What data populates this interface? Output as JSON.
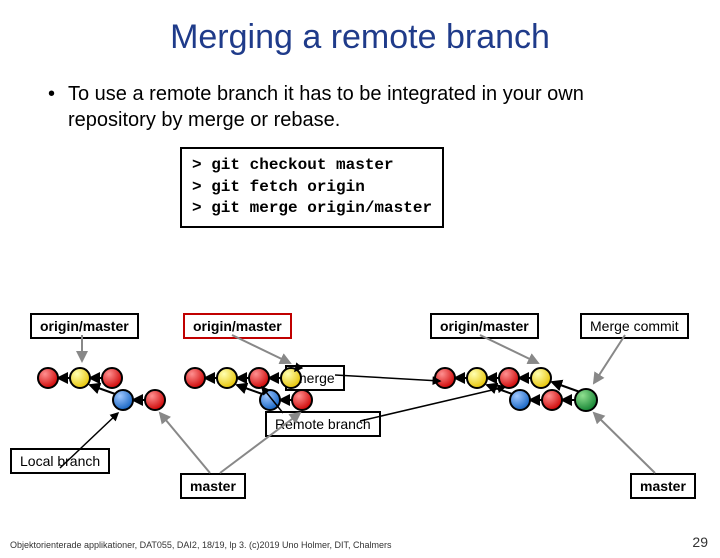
{
  "title": "Merging a remote branch",
  "bullet": "To use a remote branch it has to be integrated in your own repository by merge or rebase.",
  "code": "> git checkout master\n> git fetch origin\n> git merge origin/master",
  "labels": {
    "om1": "origin/master",
    "om2": "origin/master",
    "om3": "origin/master",
    "mergeCommit": "Merge commit",
    "merge": "merge",
    "remoteBranch": "Remote branch",
    "localBranch": "Local branch",
    "master1": "master",
    "master2": "master"
  },
  "footer": "Objektorienterade applikationer, DAT055, DAI2, 18/19, lp 3. (c)2019 Uno Holmer, DIT, Chalmers",
  "pageNum": "29"
}
